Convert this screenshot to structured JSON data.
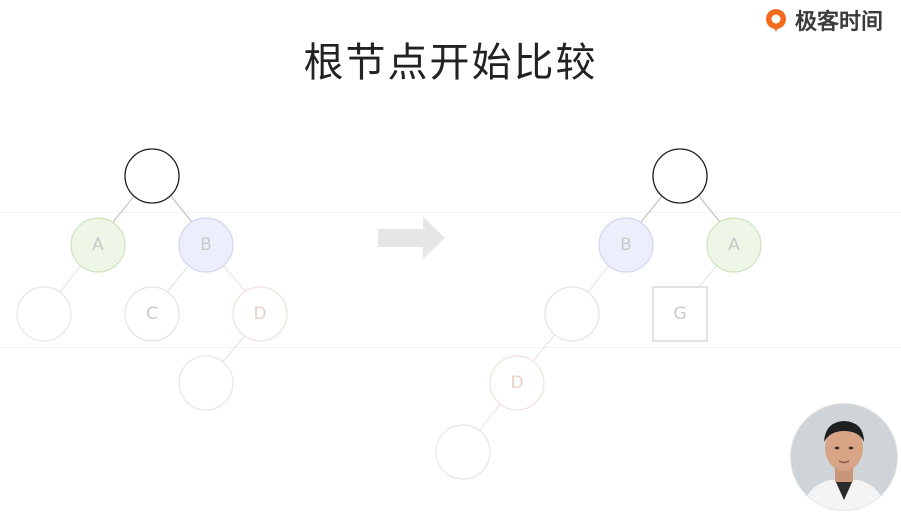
{
  "slide": {
    "title": "根节点开始比较"
  },
  "brand": {
    "name": "极客时间",
    "icon": "geektime-logo-icon",
    "color": "#f26b1d"
  },
  "left_tree": {
    "nodes": [
      {
        "id": "root",
        "label": "",
        "fill": "#ffffff",
        "stroke": "#1a1a1a"
      },
      {
        "id": "A",
        "label": "A",
        "fill": "#eef6e7",
        "stroke": "#cfe3bf"
      },
      {
        "id": "B",
        "label": "B",
        "fill": "#eceefb",
        "stroke": "#d2d6f0"
      },
      {
        "id": "L1",
        "label": "",
        "fill": "#ffffff",
        "stroke": "#e6e6e6"
      },
      {
        "id": "C",
        "label": "C",
        "fill": "#ffffff",
        "stroke": "#e3e3e3"
      },
      {
        "id": "D",
        "label": "D",
        "fill": "#ffffff",
        "stroke": "#f1e0dc"
      },
      {
        "id": "L2",
        "label": "",
        "fill": "#ffffff",
        "stroke": "#e6e6e6"
      }
    ]
  },
  "right_tree": {
    "nodes": [
      {
        "id": "root",
        "label": "",
        "fill": "#ffffff",
        "stroke": "#1a1a1a"
      },
      {
        "id": "B",
        "label": "B",
        "fill": "#eceefb",
        "stroke": "#d2d6f0"
      },
      {
        "id": "A",
        "label": "A",
        "fill": "#eef6e7",
        "stroke": "#cfe3bf"
      },
      {
        "id": "R1",
        "label": "",
        "fill": "#ffffff",
        "stroke": "#e3e3e3"
      },
      {
        "id": "G",
        "label": "G",
        "fill": "#ffffff",
        "stroke": "#d0d0d0",
        "shape": "square"
      },
      {
        "id": "D",
        "label": "D",
        "fill": "#ffffff",
        "stroke": "#f1e0dc"
      },
      {
        "id": "R2",
        "label": "",
        "fill": "#ffffff",
        "stroke": "#e6e6e6"
      }
    ]
  },
  "colors": {
    "edge": "#e2e2e2",
    "root_edge": "#bdbdbd",
    "label": "#c9c9c9",
    "label_D": "#e8cfc8",
    "arrow": "#e6e6e6"
  },
  "presenter": {
    "icon": "presenter-avatar-icon"
  }
}
